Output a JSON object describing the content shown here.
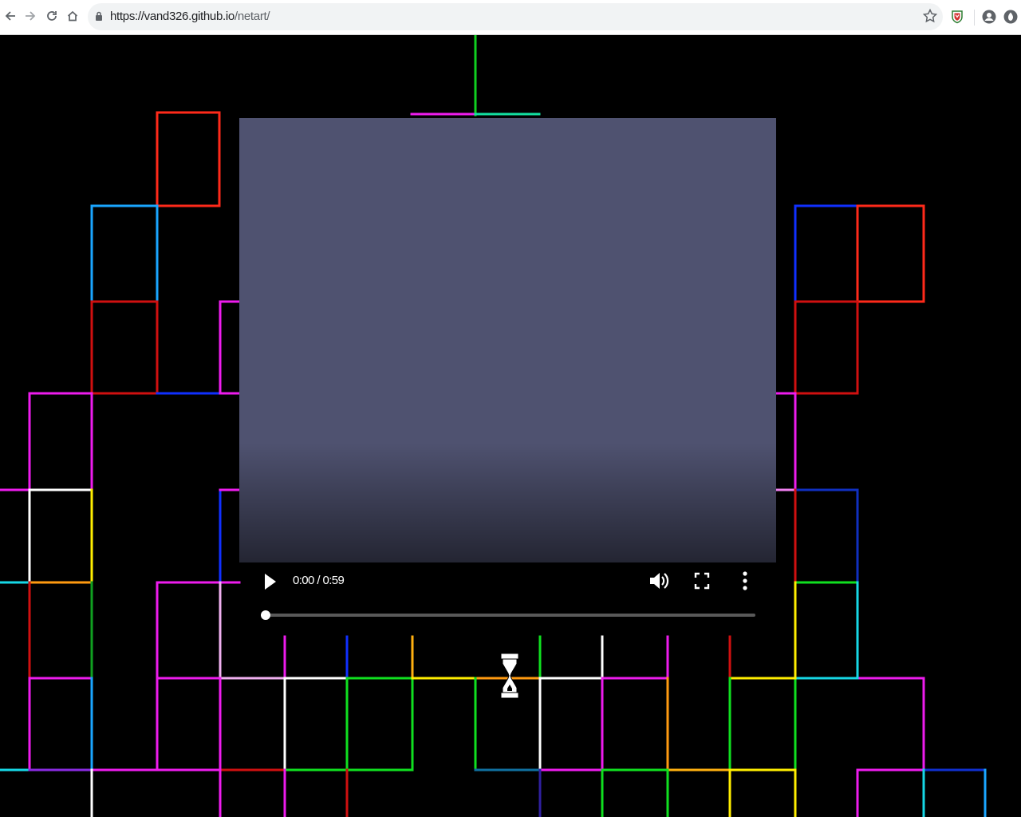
{
  "browser": {
    "url_host": "https://vand326.github.io",
    "url_path": "/netart/"
  },
  "video": {
    "current_time": "0:00",
    "duration": "0:59",
    "time_text": "0:00 / 0:59",
    "progress": 0.0,
    "background_color": "#4f5270"
  },
  "icons": {
    "back": "back-arrow-icon",
    "forward": "forward-arrow-icon",
    "reload": "reload-icon",
    "home": "home-icon",
    "lock": "lock-icon",
    "star": "bookmark-star-icon",
    "extension": "shield-extension-icon",
    "profile": "profile-icon",
    "menu": "account-icon",
    "play": "play-icon",
    "volume": "volume-icon",
    "fullscreen": "fullscreen-icon",
    "more": "more-options-icon",
    "cursor": "hourglass-cursor-icon"
  },
  "art_colors": {
    "red": "#ff2a1a",
    "magenta": "#ee1cee",
    "blue": "#1030ff",
    "cyan": "#16d8e6",
    "skyblue": "#1aa6ff",
    "green": "#10e020",
    "yellow": "#ffee00",
    "white": "#ffffff",
    "orange": "#ff9a10",
    "darkred": "#d01010"
  }
}
